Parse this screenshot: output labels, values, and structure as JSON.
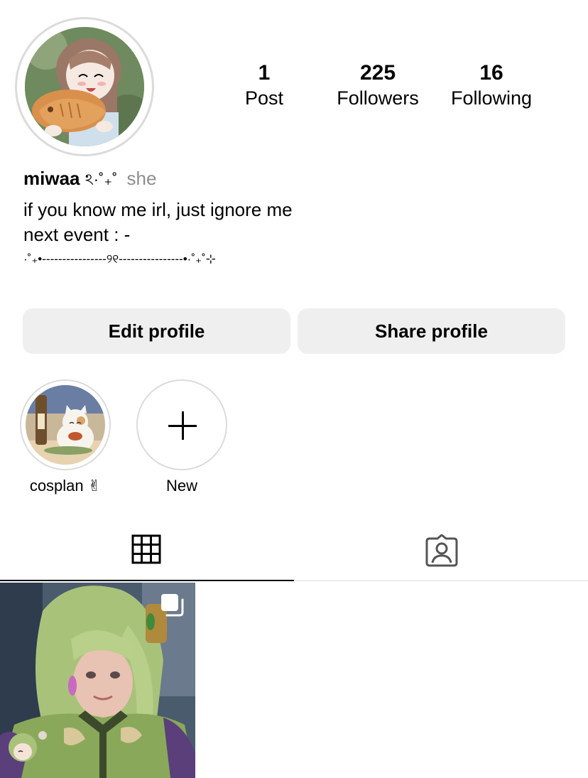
{
  "profile": {
    "avatar_icon": "profile-avatar",
    "stats": {
      "posts_count": "1",
      "posts_label": "Post",
      "followers_count": "225",
      "followers_label": "Followers",
      "following_count": "16",
      "following_label": "Following"
    },
    "username": "miwaa",
    "name_deco": "ঽ·˚₊˚",
    "pronouns": "she",
    "bio": [
      "if you know me irl, just ignore me",
      "next event : -",
      "·˚₊•----------------୨୧----------------•·˚₊˚⊹"
    ]
  },
  "actions": {
    "edit_label": "Edit profile",
    "share_label": "Share profile"
  },
  "highlights": [
    {
      "label": "cosplan ✌︎"
    },
    {
      "label": "New"
    }
  ],
  "tabs": [
    {
      "name": "grid-icon"
    },
    {
      "name": "tagged-icon"
    }
  ],
  "posts": [
    {
      "type": "carousel",
      "icon": "multi-image-icon"
    }
  ],
  "colors": {
    "button_bg": "#efefef",
    "secondary_text": "#8e8e8e",
    "border": "#dbdbdb"
  }
}
